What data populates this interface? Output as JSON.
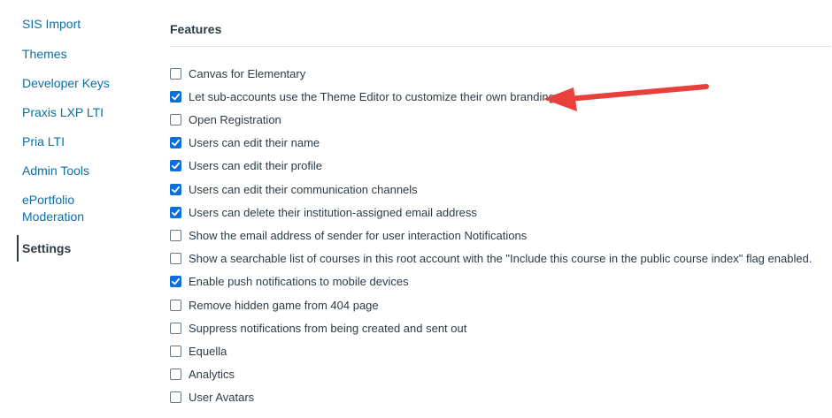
{
  "sidebar": {
    "items": [
      {
        "label": "SIS Import"
      },
      {
        "label": "Themes"
      },
      {
        "label": "Developer Keys"
      },
      {
        "label": "Praxis LXP LTI"
      },
      {
        "label": "Pria LTI"
      },
      {
        "label": "Admin Tools"
      },
      {
        "label": "ePortfolio"
      },
      {
        "label": "Moderation"
      }
    ],
    "active": "Settings"
  },
  "features": {
    "heading": "Features",
    "items": [
      {
        "label": "Canvas for Elementary",
        "checked": false
      },
      {
        "label": "Let sub-accounts use the Theme Editor to customize their own branding",
        "checked": true
      },
      {
        "label": "Open Registration",
        "checked": false
      },
      {
        "label": "Users can edit their name",
        "checked": true
      },
      {
        "label": "Users can edit their profile",
        "checked": true
      },
      {
        "label": "Users can edit their communication channels",
        "checked": true
      },
      {
        "label": "Users can delete their institution-assigned email address",
        "checked": true
      },
      {
        "label": "Show the email address of sender for user interaction Notifications",
        "checked": false
      },
      {
        "label": "Show a searchable list of courses in this root account with the \"Include this course in the public course index\" flag enabled.",
        "checked": false
      },
      {
        "label": "Enable push notifications to mobile devices",
        "checked": true
      },
      {
        "label": "Remove hidden game from 404 page",
        "checked": false
      },
      {
        "label": "Suppress notifications from being created and sent out",
        "checked": false
      },
      {
        "label": "Equella",
        "checked": false
      },
      {
        "label": "Analytics",
        "checked": false
      },
      {
        "label": "User Avatars",
        "checked": false
      }
    ]
  },
  "colors": {
    "link": "#0b6fa6",
    "checkbox_checked": "#0b6fdb",
    "annotation_arrow": "#e8413c"
  },
  "annotation": {
    "icon": "red-arrow-icon"
  }
}
